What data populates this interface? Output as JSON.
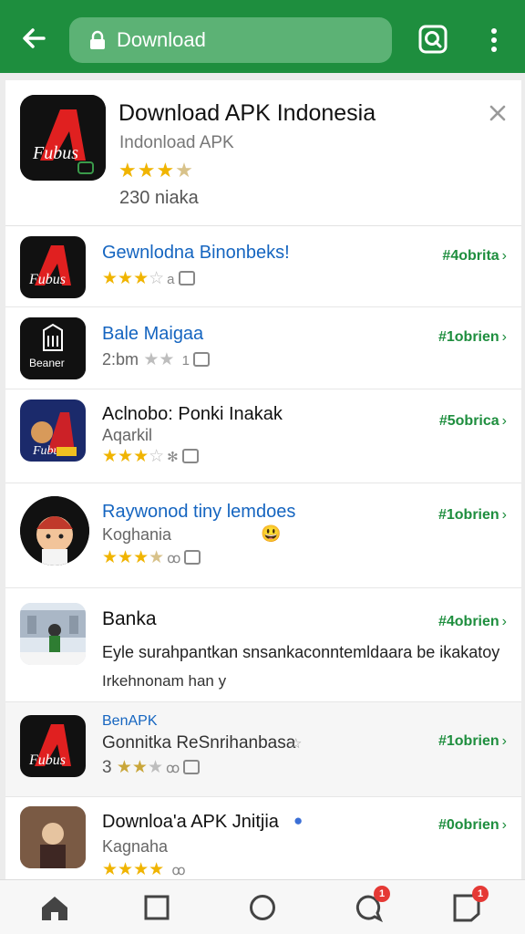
{
  "toolbar": {
    "url_text": "Download",
    "icons": [
      "back-arrow-icon",
      "lock-icon",
      "qr-scan-icon",
      "more-vertical-icon"
    ]
  },
  "hero": {
    "title": "Download APK Indonesia",
    "subtitle": "Indonload APK",
    "rating_stars": 3.5,
    "count": "230 niaka",
    "icon_label": "Fubus"
  },
  "apps": [
    {
      "name": "Gewnlodna Binonbeks!",
      "rank": "#4obrita",
      "stars": "3",
      "icon_label": "Fubus"
    },
    {
      "name": "Bale Maigaa",
      "dev": "2:bm",
      "meta": "1",
      "rank": "#1obrien",
      "icon_label": "Beaner"
    },
    {
      "name": "Aclnobo: Ponki Inakak",
      "dev": "Aqarkil",
      "rank": "#5obrica",
      "icon_label": "Fubus"
    },
    {
      "name": "Raywonod tiny lemdoes",
      "dev": "Koghania",
      "rank": "#1obrien"
    },
    {
      "name": "Banka",
      "rank": "#4obrien",
      "desc_line1": "Eyle surahpantkan snsankaconntemldaara be ikakatoy",
      "desc_line2": "Irkehnonam han y"
    },
    {
      "name_top": "BenAPK",
      "name": "Gonnitka ReSnrihanbasa",
      "stars_prefix": "3",
      "rank": "#1obrien",
      "icon_label": "Fubus"
    },
    {
      "name": "Downloa'a APK Jnitjia",
      "dev": "Kagnaha",
      "rank": "#0obrien"
    }
  ],
  "bottom_nav": {
    "items": [
      "home-icon",
      "square-icon",
      "circle-icon",
      "chat-icon",
      "notes-icon"
    ],
    "chat_badge": "1",
    "notes_badge": "1"
  },
  "colors": {
    "brand_green": "#1e8e3e",
    "star": "#f0b400",
    "link_blue": "#1565c0"
  }
}
